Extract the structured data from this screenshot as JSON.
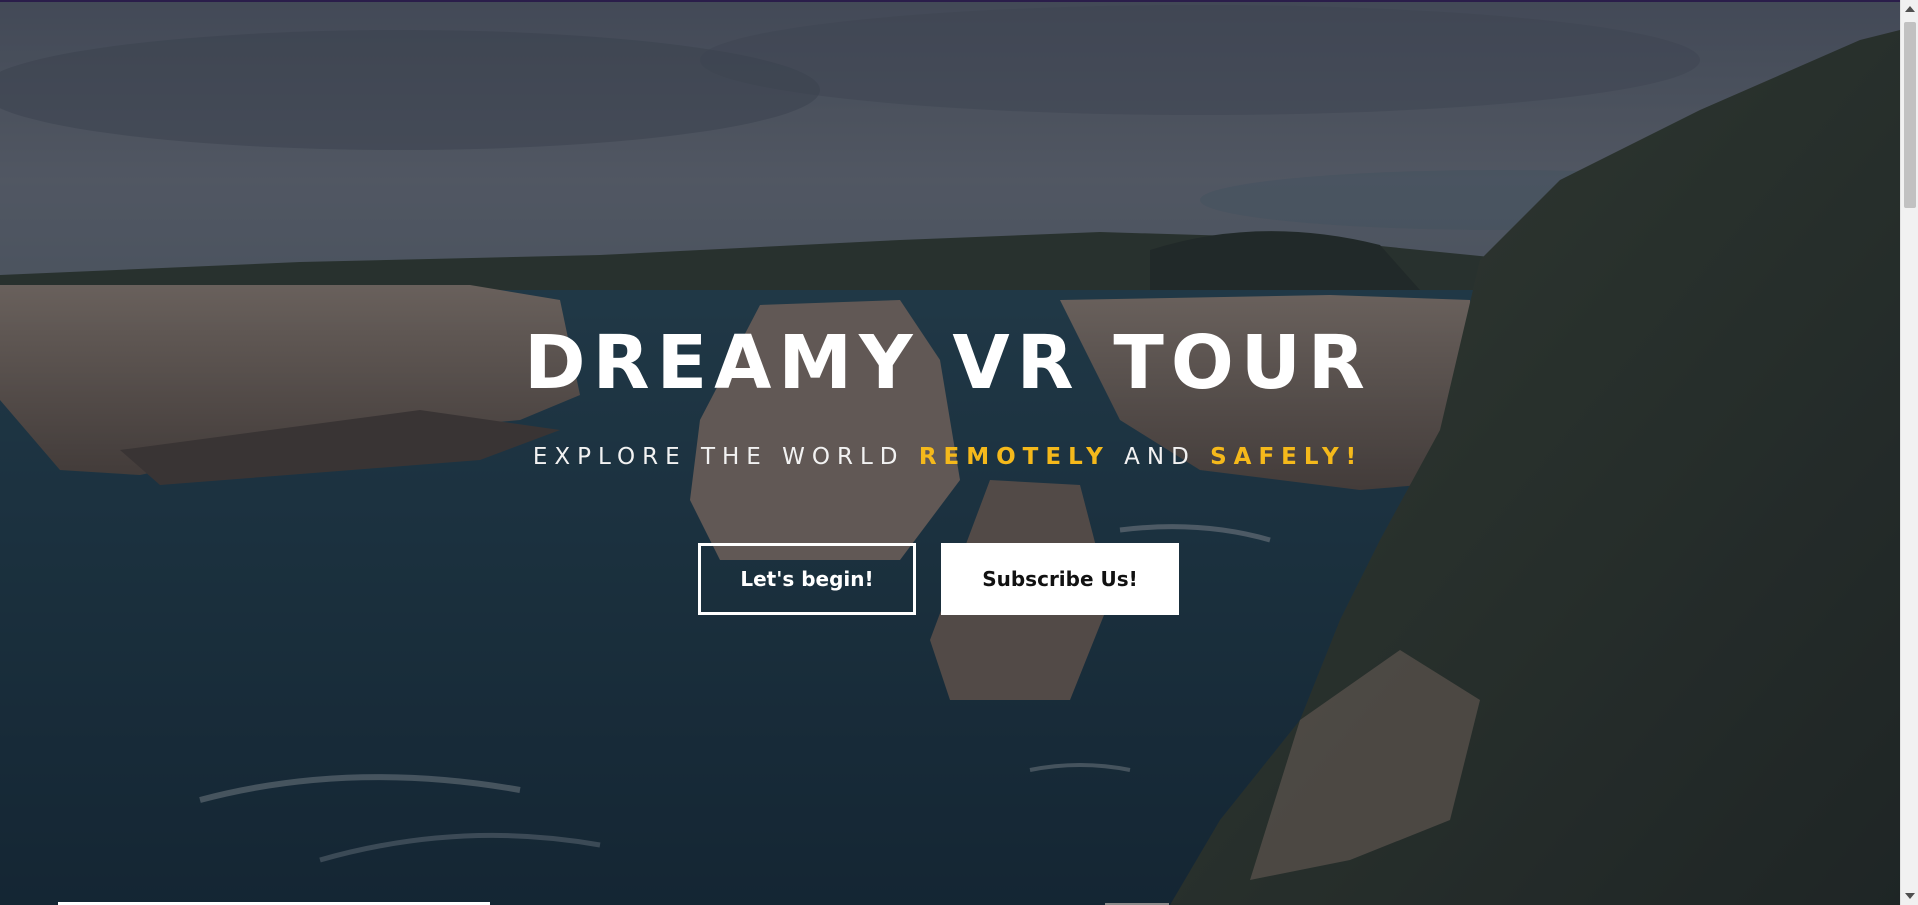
{
  "hero": {
    "title": "DREAMY VR TOUR",
    "subtitle": {
      "part1": "EXPLORE THE WORLD ",
      "highlight1": "REMOTELY",
      "part2": " AND ",
      "highlight2": "SAFELY!"
    },
    "buttons": {
      "begin_label": "Let's begin!",
      "subscribe_label": "Subscribe Us!"
    }
  },
  "colors": {
    "accent": "#f5b91b",
    "text": "#ffffff",
    "overlay": "#121826"
  },
  "icons": {
    "scroll_up": "scroll-up-arrow-icon",
    "scroll_down": "scroll-down-arrow-icon"
  }
}
